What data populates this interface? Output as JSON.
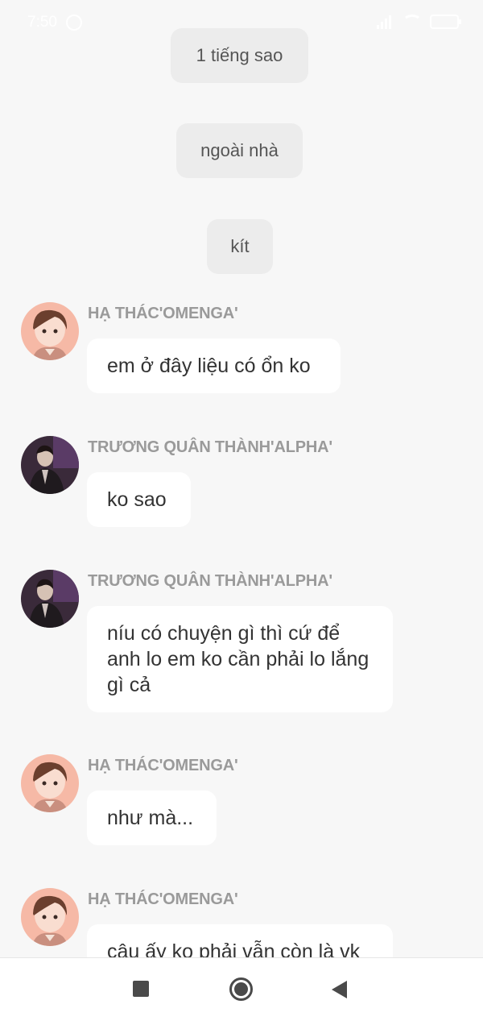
{
  "status_bar": {
    "time": "7:50"
  },
  "narrations": [
    {
      "text": "1 tiếng sao"
    },
    {
      "text": "ngoài nhà"
    },
    {
      "text": "kít"
    }
  ],
  "messages": [
    {
      "sender": "HẠ THÁC'OMENGA'",
      "text": "em ở đây liệu có ổn ko",
      "avatar": "omega-avatar"
    },
    {
      "sender": "TRƯƠNG QUÂN THÀNH'ALPHA'",
      "text": "ko sao",
      "avatar": "alpha-avatar"
    },
    {
      "sender": "TRƯƠNG QUÂN THÀNH'ALPHA'",
      "text": "níu có chuyện gì thì cứ để anh lo em ko cần phải lo lắng gì cả",
      "avatar": "alpha-avatar"
    },
    {
      "sender": "HẠ THÁC'OMENGA'",
      "text": "như mà...",
      "avatar": "omega-avatar"
    },
    {
      "sender": "HẠ THÁC'OMENGA'",
      "text": "cậu ấy ko phải vẫn còn là vk",
      "avatar": "omega-avatar"
    }
  ],
  "nav_bar": {
    "recents_icon": "square-icon",
    "home_icon": "circle-icon",
    "back_icon": "triangle-back-icon"
  }
}
